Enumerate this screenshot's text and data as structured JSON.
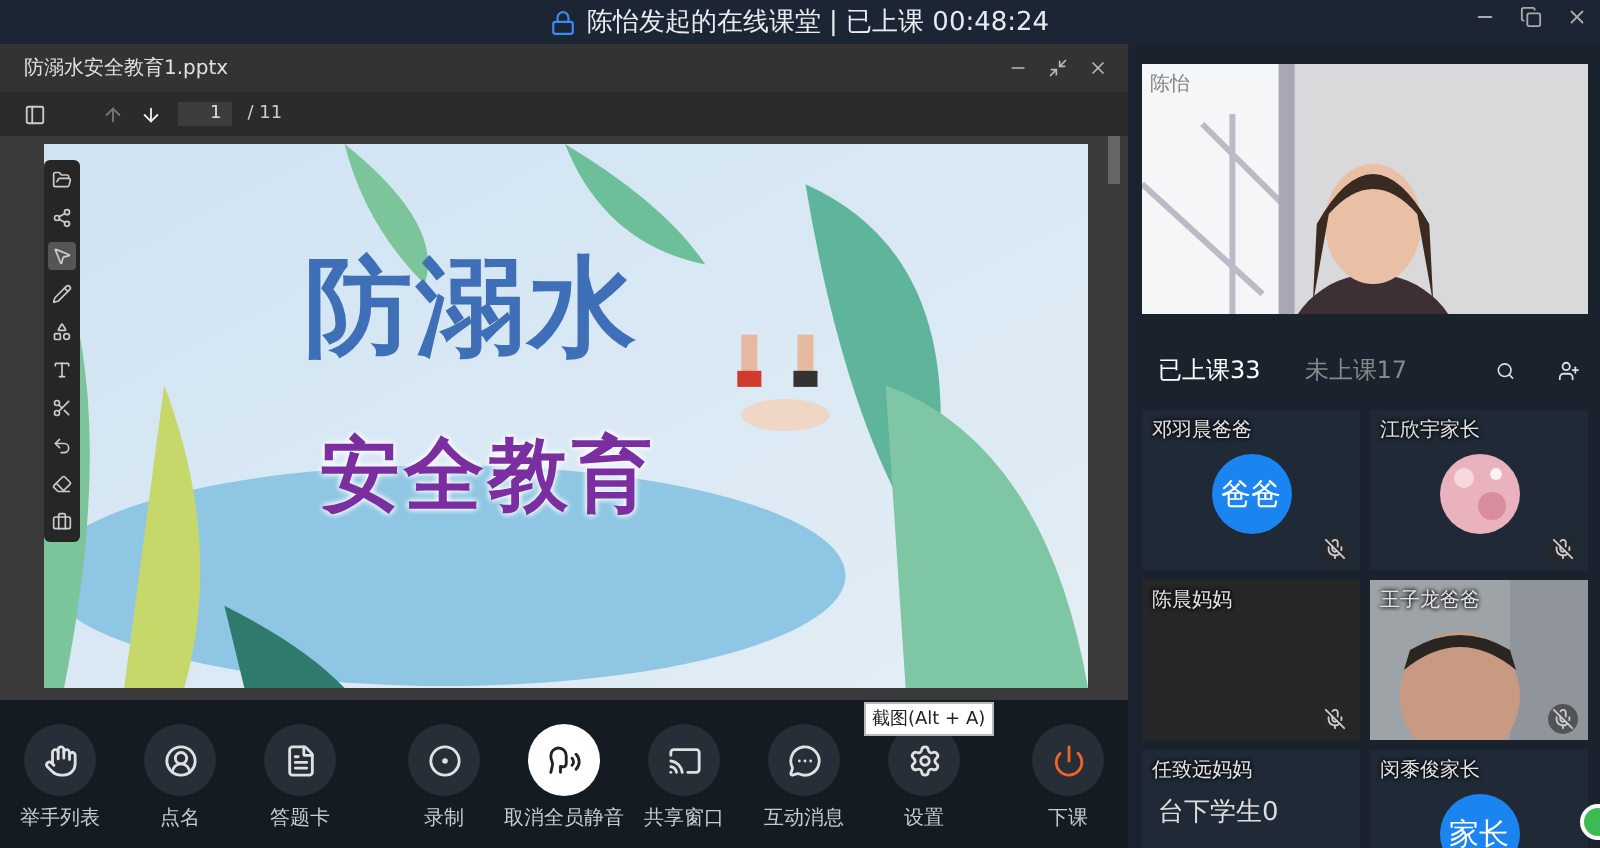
{
  "window": {
    "title": "陈怡发起的在线课堂 | 已上课 00:48:24"
  },
  "document": {
    "title": "防溺水安全教育1.pptx",
    "page": "1",
    "page_total": "/ 11",
    "slide": {
      "title": "防溺水",
      "subtitle": "安全教育"
    }
  },
  "annotation_tools": [
    {
      "selected": false
    },
    {
      "selected": false
    },
    {
      "selected": true
    },
    {
      "selected": false
    },
    {
      "selected": false
    },
    {
      "selected": false
    },
    {
      "selected": false
    },
    {
      "selected": false
    },
    {
      "selected": false
    },
    {
      "selected": false
    }
  ],
  "teacher_video": {
    "overlay_name": "陈怡"
  },
  "roster_tabs": [
    {
      "label": "已上课33",
      "selected": true
    },
    {
      "label": "未上课17",
      "selected": false
    }
  ],
  "students": [
    {
      "name": "邓羽晨爸爸",
      "kind": "avatar",
      "avatar_text": "爸爸",
      "muted": true
    },
    {
      "name": "江欣宇家长",
      "muted": true
    },
    {
      "name": "陈晨妈妈",
      "kind": "empty",
      "muted": true
    },
    {
      "name": "王子龙爸爸",
      "kind": "video",
      "muted": true
    },
    {
      "name": "任致远妈妈",
      "kind": "offstage",
      "note": "台下学生0"
    },
    {
      "name": "闵黍俊家长",
      "kind": "avatar",
      "avatar_text": "家长"
    }
  ],
  "toolbar_groups": [
    [
      {
        "label": "举手列表",
        "kind": "normal",
        "active": false
      },
      {
        "label": "点名",
        "kind": "normal",
        "active": false
      },
      {
        "label": "答题卡",
        "kind": "normal",
        "active": false
      }
    ],
    [
      {
        "label": "录制",
        "kind": "normal",
        "active": false
      },
      {
        "label": "取消全员静音",
        "kind": "normal",
        "active": true
      },
      {
        "label": "共享窗口",
        "kind": "normal",
        "active": false
      },
      {
        "label": "互动消息",
        "kind": "normal",
        "active": false
      },
      {
        "label": "设置",
        "kind": "normal",
        "active": false
      }
    ],
    [
      {
        "label": "下课",
        "kind": "danger",
        "active": false
      }
    ]
  ],
  "tooltip": {
    "text": "截图(Alt + A)"
  }
}
